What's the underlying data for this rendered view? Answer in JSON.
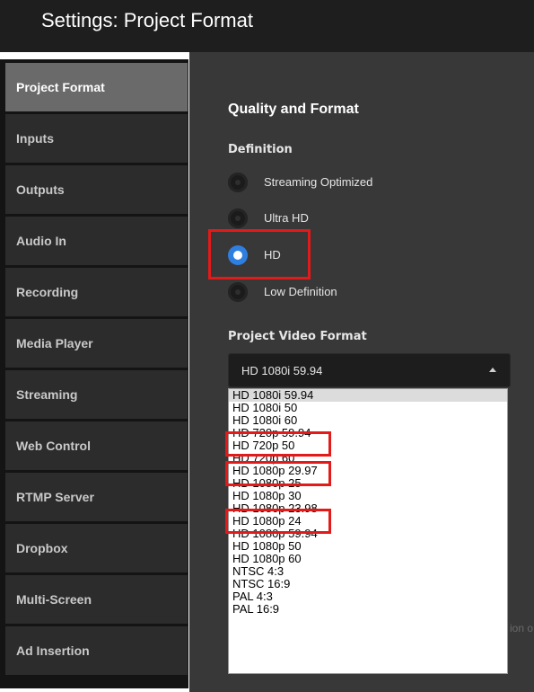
{
  "window": {
    "title": "Settings: Project Format"
  },
  "sidebar": {
    "items": [
      {
        "label": "Project Format",
        "active": true
      },
      {
        "label": "Inputs"
      },
      {
        "label": "Outputs"
      },
      {
        "label": "Audio In"
      },
      {
        "label": "Recording"
      },
      {
        "label": "Media Player"
      },
      {
        "label": "Streaming"
      },
      {
        "label": "Web Control"
      },
      {
        "label": "RTMP Server"
      },
      {
        "label": "Dropbox"
      },
      {
        "label": "Multi-Screen"
      },
      {
        "label": "Ad Insertion"
      }
    ]
  },
  "main": {
    "section_title": "Quality and Format",
    "definition": {
      "heading": "Definition",
      "options": [
        {
          "label": "Streaming Optimized",
          "selected": false
        },
        {
          "label": "Ultra HD",
          "selected": false
        },
        {
          "label": "HD",
          "selected": true
        },
        {
          "label": "Low Definition",
          "selected": false
        }
      ]
    },
    "video_format": {
      "heading": "Project Video Format",
      "selected_value": "HD 1080i 59.94",
      "options": [
        "HD 1080i 59.94",
        "HD 1080i 50",
        "HD 1080i 60",
        "HD 720p 59.94",
        "HD 720p 50",
        "HD 720p 60",
        "HD 1080p 29.97",
        "HD 1080p 25",
        "HD 1080p 30",
        "HD 1080p 23.98",
        "HD 1080p 24",
        "HD 1080p 59.94",
        "HD 1080p 50",
        "HD 1080p 60",
        "NTSC 4:3",
        "NTSC 16:9",
        "PAL 4:3",
        "PAL 16:9"
      ]
    },
    "obscured_text": "ion o"
  },
  "colors": {
    "highlight": "#e21a1a",
    "radio_selected": "#2f7fe0",
    "panel_bg": "#383838",
    "sidebar_active": "#6a6a6a"
  }
}
